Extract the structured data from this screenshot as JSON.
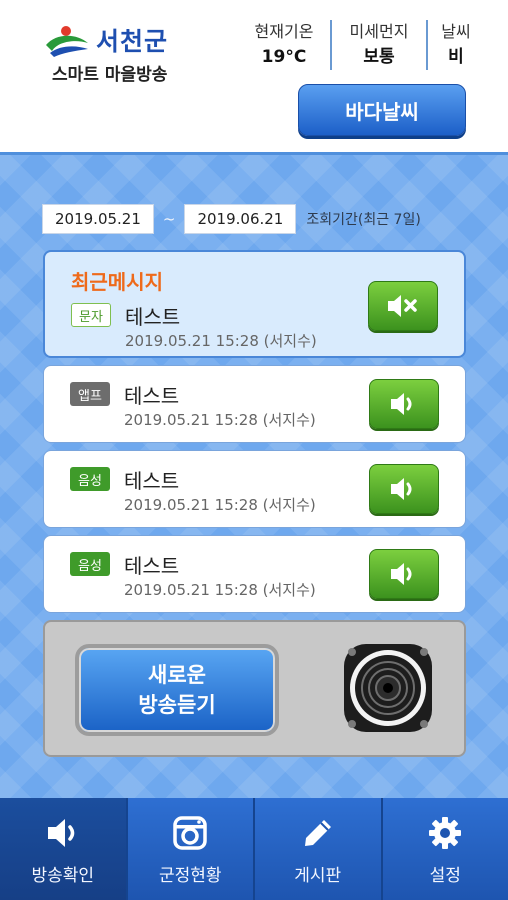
{
  "header": {
    "logo_name": "서천군",
    "logo_sub": "스마트 마을방송",
    "weather": [
      {
        "label": "현재기온",
        "value": "19°C"
      },
      {
        "label": "미세먼지",
        "value": "보통"
      },
      {
        "label": "날씨",
        "value": "비"
      }
    ],
    "sea_weather_label": "바다날씨"
  },
  "filter": {
    "start_date": "2019.05.21",
    "separator": "~",
    "end_date": "2019.06.21",
    "note": "조회기간(최근 7일)"
  },
  "recent_title": "최근메시지",
  "messages": [
    {
      "type": "문자",
      "title": "테스트",
      "meta": "2019.05.21 15:28 (서지수)",
      "button_icon": "mute-icon"
    },
    {
      "type": "앱프",
      "title": "테스트",
      "meta": "2019.05.21 15:28 (서지수)",
      "button_icon": "speaker-icon"
    },
    {
      "type": "음성",
      "title": "테스트",
      "meta": "2019.05.21 15:28 (서지수)",
      "button_icon": "speaker-icon"
    },
    {
      "type": "음성",
      "title": "테스트",
      "meta": "2019.05.21 15:28 (서지수)",
      "button_icon": "speaker-icon"
    }
  ],
  "new_broadcast": {
    "line1": "새로운",
    "line2": "방송듣기"
  },
  "nav": [
    {
      "label": "방송확인",
      "icon": "speaker-icon",
      "active": true
    },
    {
      "label": "군정현황",
      "icon": "camera-icon",
      "active": false
    },
    {
      "label": "게시판",
      "icon": "pencil-icon",
      "active": false
    },
    {
      "label": "설정",
      "icon": "gear-icon",
      "active": false
    }
  ],
  "colors": {
    "brand_blue": "#1e4fb0",
    "accent_orange": "#ee6a1b",
    "play_green": "#3c921e",
    "nav_blue": "#1e55b0"
  }
}
